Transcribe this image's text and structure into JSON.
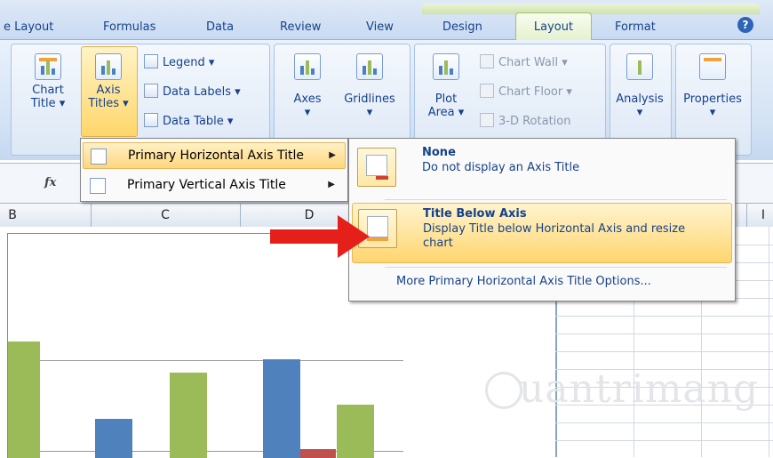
{
  "tabs": [
    "e Layout",
    "Formulas",
    "Data",
    "Review",
    "View",
    "Design",
    "Layout",
    "Format"
  ],
  "help_glyph": "?",
  "ribbon": {
    "chart_title": [
      "Chart",
      "Title ▾"
    ],
    "axis_titles": [
      "Axis",
      "Titles ▾"
    ],
    "legend": "Legend ▾",
    "data_labels": "Data Labels ▾",
    "data_table": "Data Table ▾",
    "axes": "Axes",
    "gridlines": "Gridlines",
    "plot_area": [
      "Plot",
      "Area ▾"
    ],
    "chart_wall": "Chart Wall ▾",
    "chart_floor": "Chart Floor ▾",
    "rotation": "3-D Rotation",
    "analysis": "Analysis",
    "properties": "Properties"
  },
  "formula_bar": {
    "fx": "fx"
  },
  "columns": [
    "B",
    "C",
    "D",
    "I"
  ],
  "submenu1": {
    "item1": "Primary Horizontal Axis Title",
    "item2": "Primary Vertical Axis Title"
  },
  "submenu2": {
    "none_title": "None",
    "none_desc": "Do not display an Axis Title",
    "below_title": "Title Below Axis",
    "below_desc": "Display Title below Horizontal Axis and resize chart",
    "more": "More Primary Horizontal Axis Title Options..."
  },
  "watermark": "uantrimang",
  "colors": {
    "accent_red": "#e5201b",
    "bar_blue": "#4f81bd",
    "bar_green": "#9bbb59",
    "bar_red": "#c0504d"
  }
}
